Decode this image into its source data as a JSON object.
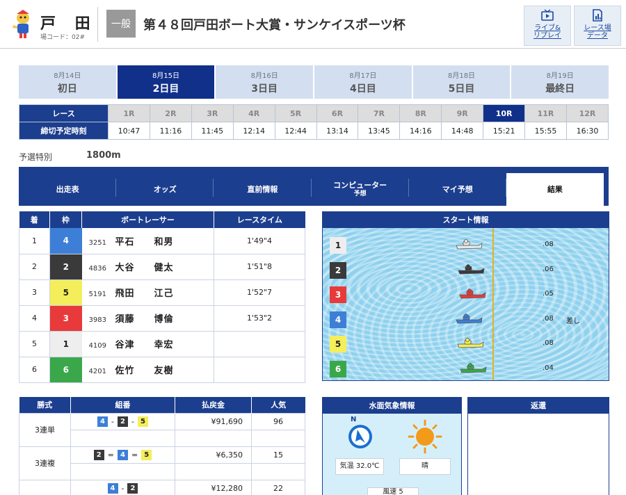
{
  "header": {
    "venue": "戸 田",
    "venue_code": "場コード：02#",
    "grade": "一般",
    "race_title": "第４８回戸田ボート大賞・サンケイスポーツ杯",
    "buttons": [
      {
        "label1": "ライブ&",
        "label2": "リプレイ",
        "icon": "tv-play-icon"
      },
      {
        "label1": "レース場",
        "label2": "データ",
        "icon": "chart-doc-icon"
      }
    ]
  },
  "days": [
    {
      "date": "8月14日",
      "name": "初日",
      "active": false
    },
    {
      "date": "8月15日",
      "name": "2日目",
      "active": true
    },
    {
      "date": "8月16日",
      "name": "3日目",
      "active": false
    },
    {
      "date": "8月17日",
      "name": "4日目",
      "active": false
    },
    {
      "date": "8月18日",
      "name": "5日目",
      "active": false
    },
    {
      "date": "8月19日",
      "name": "最終日",
      "active": false
    }
  ],
  "race_table": {
    "row1_label": "レース",
    "row2_label": "締切予定時刻",
    "races": [
      "1R",
      "2R",
      "3R",
      "4R",
      "5R",
      "6R",
      "7R",
      "8R",
      "9R",
      "10R",
      "11R",
      "12R"
    ],
    "times": [
      "10:47",
      "11:16",
      "11:45",
      "12:14",
      "12:44",
      "13:14",
      "13:45",
      "14:16",
      "14:48",
      "15:21",
      "15:55",
      "16:30"
    ],
    "active_index": 9
  },
  "race_info": {
    "type": "予選特別",
    "distance": "1800m"
  },
  "subtabs": [
    {
      "label": "出走表",
      "sub": ""
    },
    {
      "label": "オッズ",
      "sub": ""
    },
    {
      "label": "直前情報",
      "sub": ""
    },
    {
      "label": "コンピューター",
      "sub": "予想"
    },
    {
      "label": "マイ予想",
      "sub": ""
    },
    {
      "label": "結果",
      "sub": ""
    }
  ],
  "subtab_active": 5,
  "results": {
    "headers": [
      "着",
      "枠",
      "ボートレーサー",
      "レースタイム"
    ],
    "rows": [
      {
        "place": "1",
        "frame": "4",
        "reg": "3251",
        "name": "平石　　和男",
        "time": "1'49\"4"
      },
      {
        "place": "2",
        "frame": "2",
        "reg": "4836",
        "name": "大谷　　健太",
        "time": "1'51\"8"
      },
      {
        "place": "3",
        "frame": "5",
        "reg": "5191",
        "name": "飛田　　江己",
        "time": "1'52\"7"
      },
      {
        "place": "4",
        "frame": "3",
        "reg": "3983",
        "name": "須藤　　博倫",
        "time": "1'53\"2"
      },
      {
        "place": "5",
        "frame": "1",
        "reg": "4109",
        "name": "谷津　　幸宏",
        "time": ""
      },
      {
        "place": "6",
        "frame": "6",
        "reg": "4201",
        "name": "佐竹　　友樹",
        "time": ""
      }
    ]
  },
  "start_info": {
    "title": "スタート情報",
    "rows": [
      {
        "frame": "1",
        "st": ".08",
        "note": "",
        "boat_color": "#e8e8e8"
      },
      {
        "frame": "2",
        "st": ".06",
        "note": "",
        "boat_color": "#3a3a3a"
      },
      {
        "frame": "3",
        "st": ".05",
        "note": "",
        "boat_color": "#e83a3a"
      },
      {
        "frame": "4",
        "st": ".08",
        "note": "差し",
        "boat_color": "#3d7fd6"
      },
      {
        "frame": "5",
        "st": ".08",
        "note": "",
        "boat_color": "#f3ee5a"
      },
      {
        "frame": "6",
        "st": ".04",
        "note": "",
        "boat_color": "#3aa84a"
      }
    ]
  },
  "payouts": {
    "headers": [
      "勝式",
      "組番",
      "払戻金",
      "人気"
    ],
    "rows": [
      {
        "type": "3連単",
        "combo": [
          "4",
          "2",
          "5"
        ],
        "sep": "-",
        "amount": "¥91,690",
        "pop": "96"
      },
      {
        "type": "3連複",
        "combo": [
          "2",
          "4",
          "5"
        ],
        "sep": "=",
        "amount": "¥6,350",
        "pop": "15"
      },
      {
        "type": "",
        "combo": [
          "4",
          "2"
        ],
        "sep": "-",
        "amount": "¥12,280",
        "pop": "22"
      }
    ]
  },
  "weather": {
    "title": "水面気象情報",
    "compass_label": "N",
    "temp": "気温 32.0℃",
    "condition": "晴",
    "partial": "風速 5"
  },
  "refund": {
    "title": "返還"
  }
}
